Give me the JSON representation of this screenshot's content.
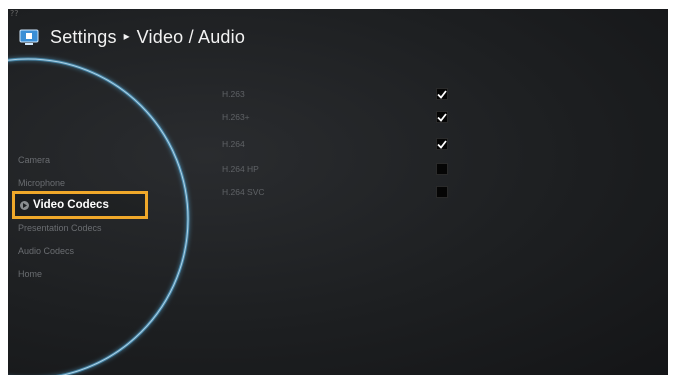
{
  "header": {
    "corner_label": "??",
    "title": "Settings",
    "separator": "▸",
    "subtitle": "Video / Audio",
    "icon": "monitor-icon"
  },
  "menu": {
    "items": [
      {
        "label": "Camera"
      },
      {
        "label": "Microphone"
      },
      {
        "label": "Video Codecs",
        "selected": true
      },
      {
        "label": "Presentation Codecs"
      },
      {
        "label": "Audio Codecs"
      },
      {
        "label": "Home"
      }
    ]
  },
  "codecs": [
    {
      "label": "H.263",
      "checked": true
    },
    {
      "label": "H.263+",
      "checked": true
    },
    {
      "label": "H.264",
      "checked": true
    },
    {
      "label": "H.264 HP",
      "checked": false
    },
    {
      "label": "H.264 SVC",
      "checked": false
    }
  ],
  "colors": {
    "background": "#1d1f21",
    "highlight": "#f0a82a",
    "accent_glow": "#6fc3ee",
    "icon_blue": "#3a8fd6"
  }
}
